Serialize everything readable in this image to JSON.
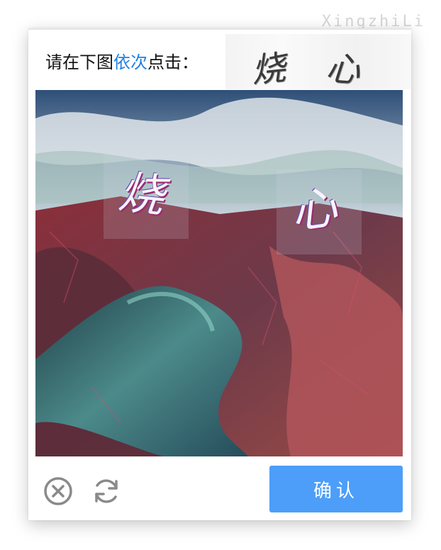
{
  "watermark": "XingzhiLi",
  "prompt": {
    "before": "请在下图",
    "highlight": "依次",
    "after": "点击："
  },
  "target_chars": [
    "烧",
    "心"
  ],
  "image_chars": [
    "烧",
    "心"
  ],
  "footer": {
    "close_icon": "close-circle-icon",
    "refresh_icon": "refresh-icon",
    "confirm_label": "确认"
  },
  "colors": {
    "accent": "#4c9ef9",
    "highlight_text": "#1f80e6"
  }
}
